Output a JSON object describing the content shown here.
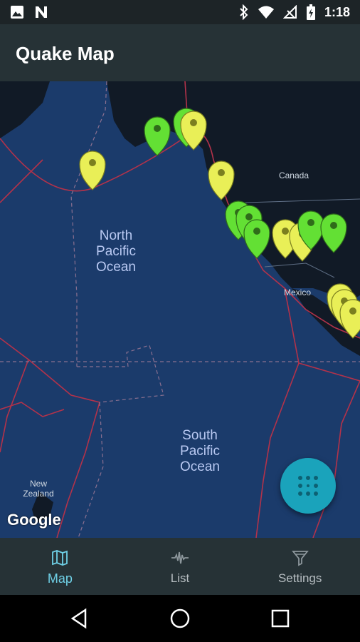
{
  "status_bar": {
    "time": "1:18",
    "left_icons": [
      "image-icon",
      "n-app-icon"
    ],
    "right_icons": [
      "bluetooth-icon",
      "wifi-icon",
      "no-signal-icon",
      "battery-icon"
    ]
  },
  "app_bar": {
    "title": "Quake Map"
  },
  "map": {
    "labels": {
      "north_pacific": "North\nPacific\nOcean",
      "south_pacific": "South\nPacific\nOcean",
      "canada": "Canada",
      "mexico": "Mexico",
      "new_zealand": "New\nZealand"
    },
    "attribution": "Google",
    "markers": [
      {
        "color": "green"
      },
      {
        "color": "green"
      },
      {
        "color": "yellow"
      },
      {
        "color": "yellow"
      },
      {
        "color": "yellow"
      },
      {
        "color": "green"
      },
      {
        "color": "green"
      },
      {
        "color": "green"
      },
      {
        "color": "yellow"
      },
      {
        "color": "yellow"
      },
      {
        "color": "green"
      },
      {
        "color": "green"
      },
      {
        "color": "yellow"
      },
      {
        "color": "yellow"
      },
      {
        "color": "yellow"
      }
    ],
    "colors": {
      "ocean": "#1b3b6b",
      "land": "#111a26",
      "plate_boundary": "#b3324a",
      "marker_green": "#63e034",
      "marker_yellow": "#e9ef57"
    }
  },
  "fab": {
    "icon": "dots-pattern-icon"
  },
  "bottom_nav": {
    "items": [
      {
        "label": "Map",
        "icon": "map-icon",
        "active": true
      },
      {
        "label": "List",
        "icon": "waveform-icon",
        "active": false
      },
      {
        "label": "Settings",
        "icon": "filter-icon",
        "active": false
      }
    ],
    "accent": "#6fd0e6"
  },
  "system_nav": {
    "buttons": [
      "back-button",
      "home-button",
      "recents-button"
    ]
  }
}
